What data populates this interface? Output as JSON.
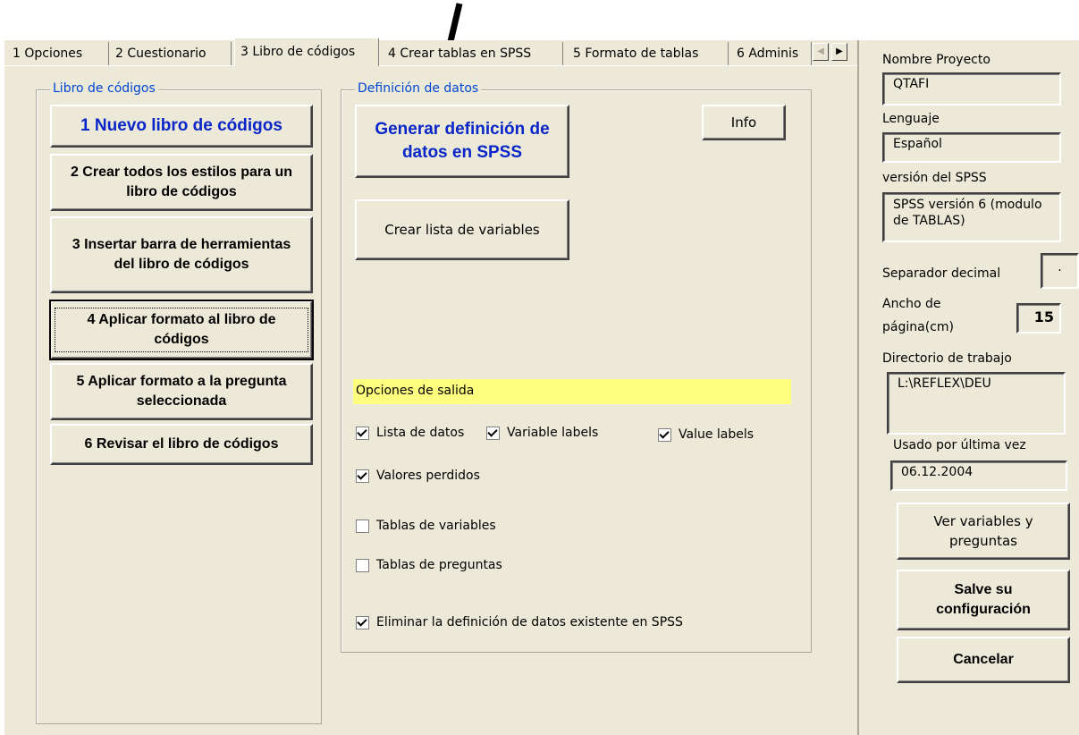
{
  "tabs": [
    {
      "label": "1 Opciones"
    },
    {
      "label": "2 Cuestionario"
    },
    {
      "label": "3 Libro de códigos"
    },
    {
      "label": "4 Crear tablas en SPSS"
    },
    {
      "label": "5 Formato de tablas"
    },
    {
      "label": "6 Adminis"
    }
  ],
  "scroll": {
    "left": "◀",
    "right": "▶"
  },
  "codebook_group": {
    "legend": "Libro de códigos",
    "buttons": [
      "1 Nuevo libro de códigos",
      "2 Crear todos los estilos para un libro de códigos",
      "3 Insertar barra de herramientas del libro de códigos",
      "4 Aplicar formato al libro de códigos",
      "5 Aplicar formato a la pregunta seleccionada",
      "6 Revisar el libro de códigos"
    ]
  },
  "data_group": {
    "legend": "Definición de datos",
    "generate_btn": "Generar definición de datos en SPSS",
    "info_btn": "Info",
    "varlist_btn": "Crear lista de variables",
    "output_header": "Opciones de salida",
    "checks": {
      "data_list": {
        "label": "Lista de datos",
        "checked": true
      },
      "variable_labels": {
        "label": "Variable labels",
        "checked": true
      },
      "value_labels": {
        "label": "Value labels",
        "checked": true
      },
      "missing_values": {
        "label": "Valores perdidos",
        "checked": true
      },
      "var_tables": {
        "label": "Tablas de variables",
        "checked": false
      },
      "question_tables": {
        "label": "Tablas de preguntas",
        "checked": false
      },
      "delete_existing": {
        "label": "Eliminar la definición de datos existente en SPSS",
        "checked": true
      }
    }
  },
  "right": {
    "project_label": "Nombre Proyecto",
    "project_value": "QTAFI",
    "language_label": "Lenguaje",
    "language_value": "Español",
    "spss_label": "versión del SPSS",
    "spss_value": "SPSS versión 6 (modulo de TABLAS)",
    "decimal_label": "Separador decimal",
    "decimal_value": ".",
    "width_label_1": "Ancho de",
    "width_label_2": "página(cm)",
    "width_value": "15",
    "dir_label": "Directorio de trabajo",
    "dir_value": "L:\\REFLEX\\DEU",
    "last_used_label": "Usado por última vez",
    "last_used_value": "06.12.2004",
    "view_btn": "Ver variables y preguntas",
    "save_btn": "Salve su configuración",
    "cancel_btn": "Cancelar"
  }
}
